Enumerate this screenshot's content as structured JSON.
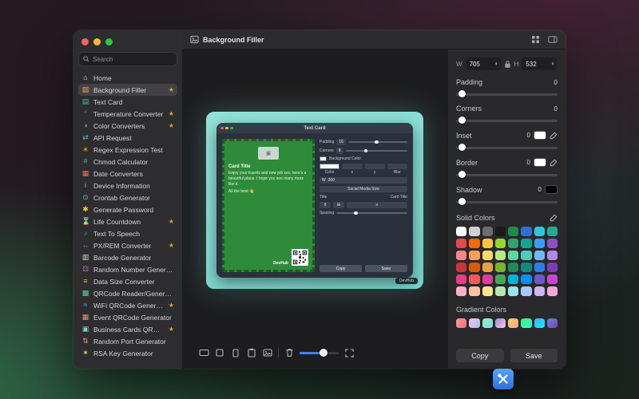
{
  "window": {
    "title": "Background Filler"
  },
  "sidebar": {
    "search_placeholder": "Search",
    "items": [
      {
        "label": "Home",
        "glyph": "⌂",
        "color": "#d9d9de",
        "starred": false,
        "selected": false
      },
      {
        "label": "Background Filler",
        "glyph": "▨",
        "color": "#e8a33d",
        "starred": true,
        "selected": true
      },
      {
        "label": "Text Card",
        "glyph": "▤",
        "color": "#4db6ac",
        "starred": false,
        "selected": false
      },
      {
        "label": "Temperature Converter",
        "glyph": "°",
        "color": "#e05b5b",
        "starred": true,
        "selected": false
      },
      {
        "label": "Color Converters",
        "glyph": "◑",
        "color": "#af7ac5",
        "starred": true,
        "selected": false
      },
      {
        "label": "API Request",
        "glyph": "⇄",
        "color": "#5dade2",
        "starred": false,
        "selected": false
      },
      {
        "label": "Regex Expression Test",
        "glyph": "∗",
        "color": "#f39c12",
        "starred": false,
        "selected": false
      },
      {
        "label": "Chmod Calculator",
        "glyph": "#",
        "color": "#52be80",
        "starred": false,
        "selected": false
      },
      {
        "label": "Date Converters",
        "glyph": "▦",
        "color": "#ec7063",
        "starred": false,
        "selected": false
      },
      {
        "label": "Device Information",
        "glyph": "i",
        "color": "#85c1e9",
        "starred": false,
        "selected": false
      },
      {
        "label": "Crontab Generator",
        "glyph": "⊙",
        "color": "#48c9b0",
        "starred": false,
        "selected": false
      },
      {
        "label": "Generate Password",
        "glyph": "✱",
        "color": "#f4d03f",
        "starred": false,
        "selected": false
      },
      {
        "label": "Life Countdown",
        "glyph": "⌛",
        "color": "#cd6155",
        "starred": true,
        "selected": false
      },
      {
        "label": "Text To Speech",
        "glyph": "♪",
        "color": "#5499c7",
        "starred": false,
        "selected": false
      },
      {
        "label": "PX/REM Converter",
        "glyph": "↔",
        "color": "#45b39d",
        "starred": true,
        "selected": false
      },
      {
        "label": "Barcode Generator",
        "glyph": "▥",
        "color": "#d9d9de",
        "starred": false,
        "selected": false
      },
      {
        "label": "Random Number Generator",
        "glyph": "⚄",
        "color": "#a569bd",
        "starred": false,
        "selected": false
      },
      {
        "label": "Data Size Converter",
        "glyph": "≡",
        "color": "#f5b041",
        "starred": false,
        "selected": false
      },
      {
        "label": "QRCode Reader/Generator",
        "glyph": "▩",
        "color": "#58d68d",
        "starred": false,
        "selected": false
      },
      {
        "label": "WiFi QRCode Generator",
        "glyph": "≈",
        "color": "#5dade2",
        "starred": true,
        "selected": false
      },
      {
        "label": "Event QRCode Generator",
        "glyph": "▦",
        "color": "#e59866",
        "starred": false,
        "selected": false
      },
      {
        "label": "Business Cards QRCode...",
        "glyph": "▣",
        "color": "#76d7c4",
        "starred": true,
        "selected": false
      },
      {
        "label": "Random Port Generator",
        "glyph": "⇅",
        "color": "#f1948a",
        "starred": false,
        "selected": false
      },
      {
        "label": "RSA Key Generator",
        "glyph": "✶",
        "color": "#f7dc6f",
        "starred": false,
        "selected": false
      }
    ]
  },
  "preview": {
    "window_title": "Text Card",
    "card": {
      "title": "Card Title",
      "body": "Enjoy your travels and new job xxx, here's a beautiful place. I hope you see many more like it.",
      "closing": "All the best 👋",
      "brand": "DevHub"
    },
    "controls": {
      "padding_label": "Padding",
      "padding_value": "16",
      "corners_label": "Corners",
      "corners_value": "8",
      "bg_color_label": "Background Color",
      "color_label": "Color",
      "x_label": "x",
      "y_label": "y",
      "blur_label": "Blur",
      "w_label": "W",
      "w_value": "300",
      "size_button": "Social Media Size",
      "title_label": "Title",
      "title_value": "Card Title",
      "font_size": "9",
      "spacing_label": "Spacing",
      "copy": "Copy",
      "save": "Save"
    },
    "watermark": "DevHub"
  },
  "inspector": {
    "w_label": "W",
    "w_value": "705",
    "h_label": "H",
    "h_value": "532",
    "sliders": [
      {
        "label": "Padding",
        "value": "0"
      },
      {
        "label": "Corners",
        "value": "0"
      },
      {
        "label": "Inset",
        "value": "0",
        "chip": "#ffffff"
      },
      {
        "label": "Border",
        "value": "0",
        "chip": "#ffffff"
      },
      {
        "label": "Shadow",
        "value": "0",
        "chip": "#000000"
      }
    ],
    "solid_colors_label": "Solid Colors",
    "solid_colors": [
      "#ffffff",
      "#cfcfd4",
      "#6b6b70",
      "#1a1a1c",
      "#1f8a4c",
      "#2f6fd6",
      "#2bc8d9",
      "#27a98f",
      "#e5484d",
      "#f76808",
      "#ffc53d",
      "#99d52a",
      "#30a46c",
      "#12a594",
      "#369eff",
      "#8e4ec6",
      "#ff8589",
      "#ff9e5e",
      "#ffd86b",
      "#b8e986",
      "#5bd8a0",
      "#53c9bd",
      "#74b9ff",
      "#b187e8",
      "#c93538",
      "#d95d08",
      "#e8a33d",
      "#7fb32a",
      "#1e8a5a",
      "#0f8a7d",
      "#2a7fe0",
      "#7a3db8",
      "#e93d82",
      "#f25c54",
      "#d6409f",
      "#46a758",
      "#00b4d8",
      "#0090ff",
      "#6e56cf",
      "#c944d6",
      "#ffafc5",
      "#ffc29e",
      "#ffe58a",
      "#b5e8b0",
      "#9ae6f0",
      "#a8c8ff",
      "#cbb5f5",
      "#f5a8dd"
    ],
    "gradient_colors_label": "Gradient Colors",
    "gradient_colors": [
      [
        "#ff9a8b",
        "#ff6a88"
      ],
      [
        "#fbc2eb",
        "#a6c1ee"
      ],
      [
        "#84fab0",
        "#8fd3f4"
      ],
      [
        "#a18cd1",
        "#fbc2eb"
      ],
      [
        "#f6d365",
        "#fda085"
      ],
      [
        "#43e97b",
        "#38f9d7"
      ],
      [
        "#4facfe",
        "#00f2fe"
      ],
      [
        "#667eea",
        "#764ba2"
      ]
    ],
    "copy": "Copy",
    "save": "Save"
  }
}
